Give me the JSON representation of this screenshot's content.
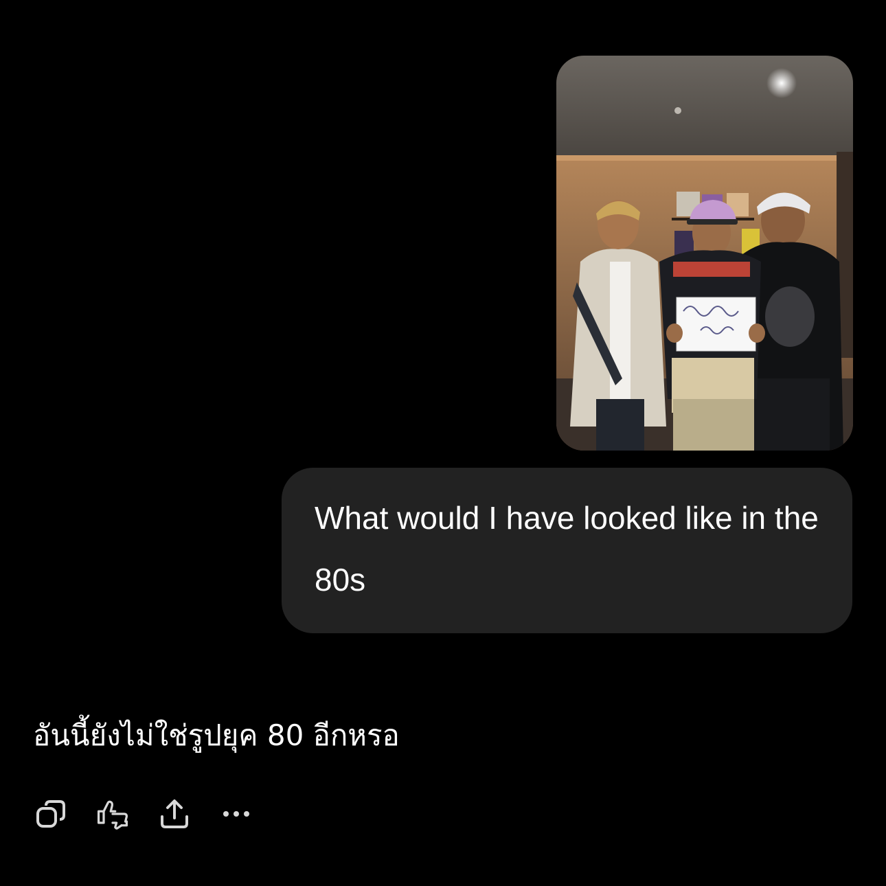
{
  "conversation": {
    "user_image": {
      "kind": "photo",
      "alt": ""
    },
    "user_message": "What would I have looked like in the 80s",
    "assistant_reply": "อันนี้ยังไม่ใช่รูปยุค 80 อีกหรอ"
  },
  "actions": {
    "icons": [
      "copy-icon",
      "thumbs-up-down-icon",
      "share-icon",
      "more-icon"
    ]
  },
  "colors": {
    "background": "#000000",
    "bubble": "#222222",
    "text": "#ffffff",
    "icon": "#d8d8d8"
  }
}
